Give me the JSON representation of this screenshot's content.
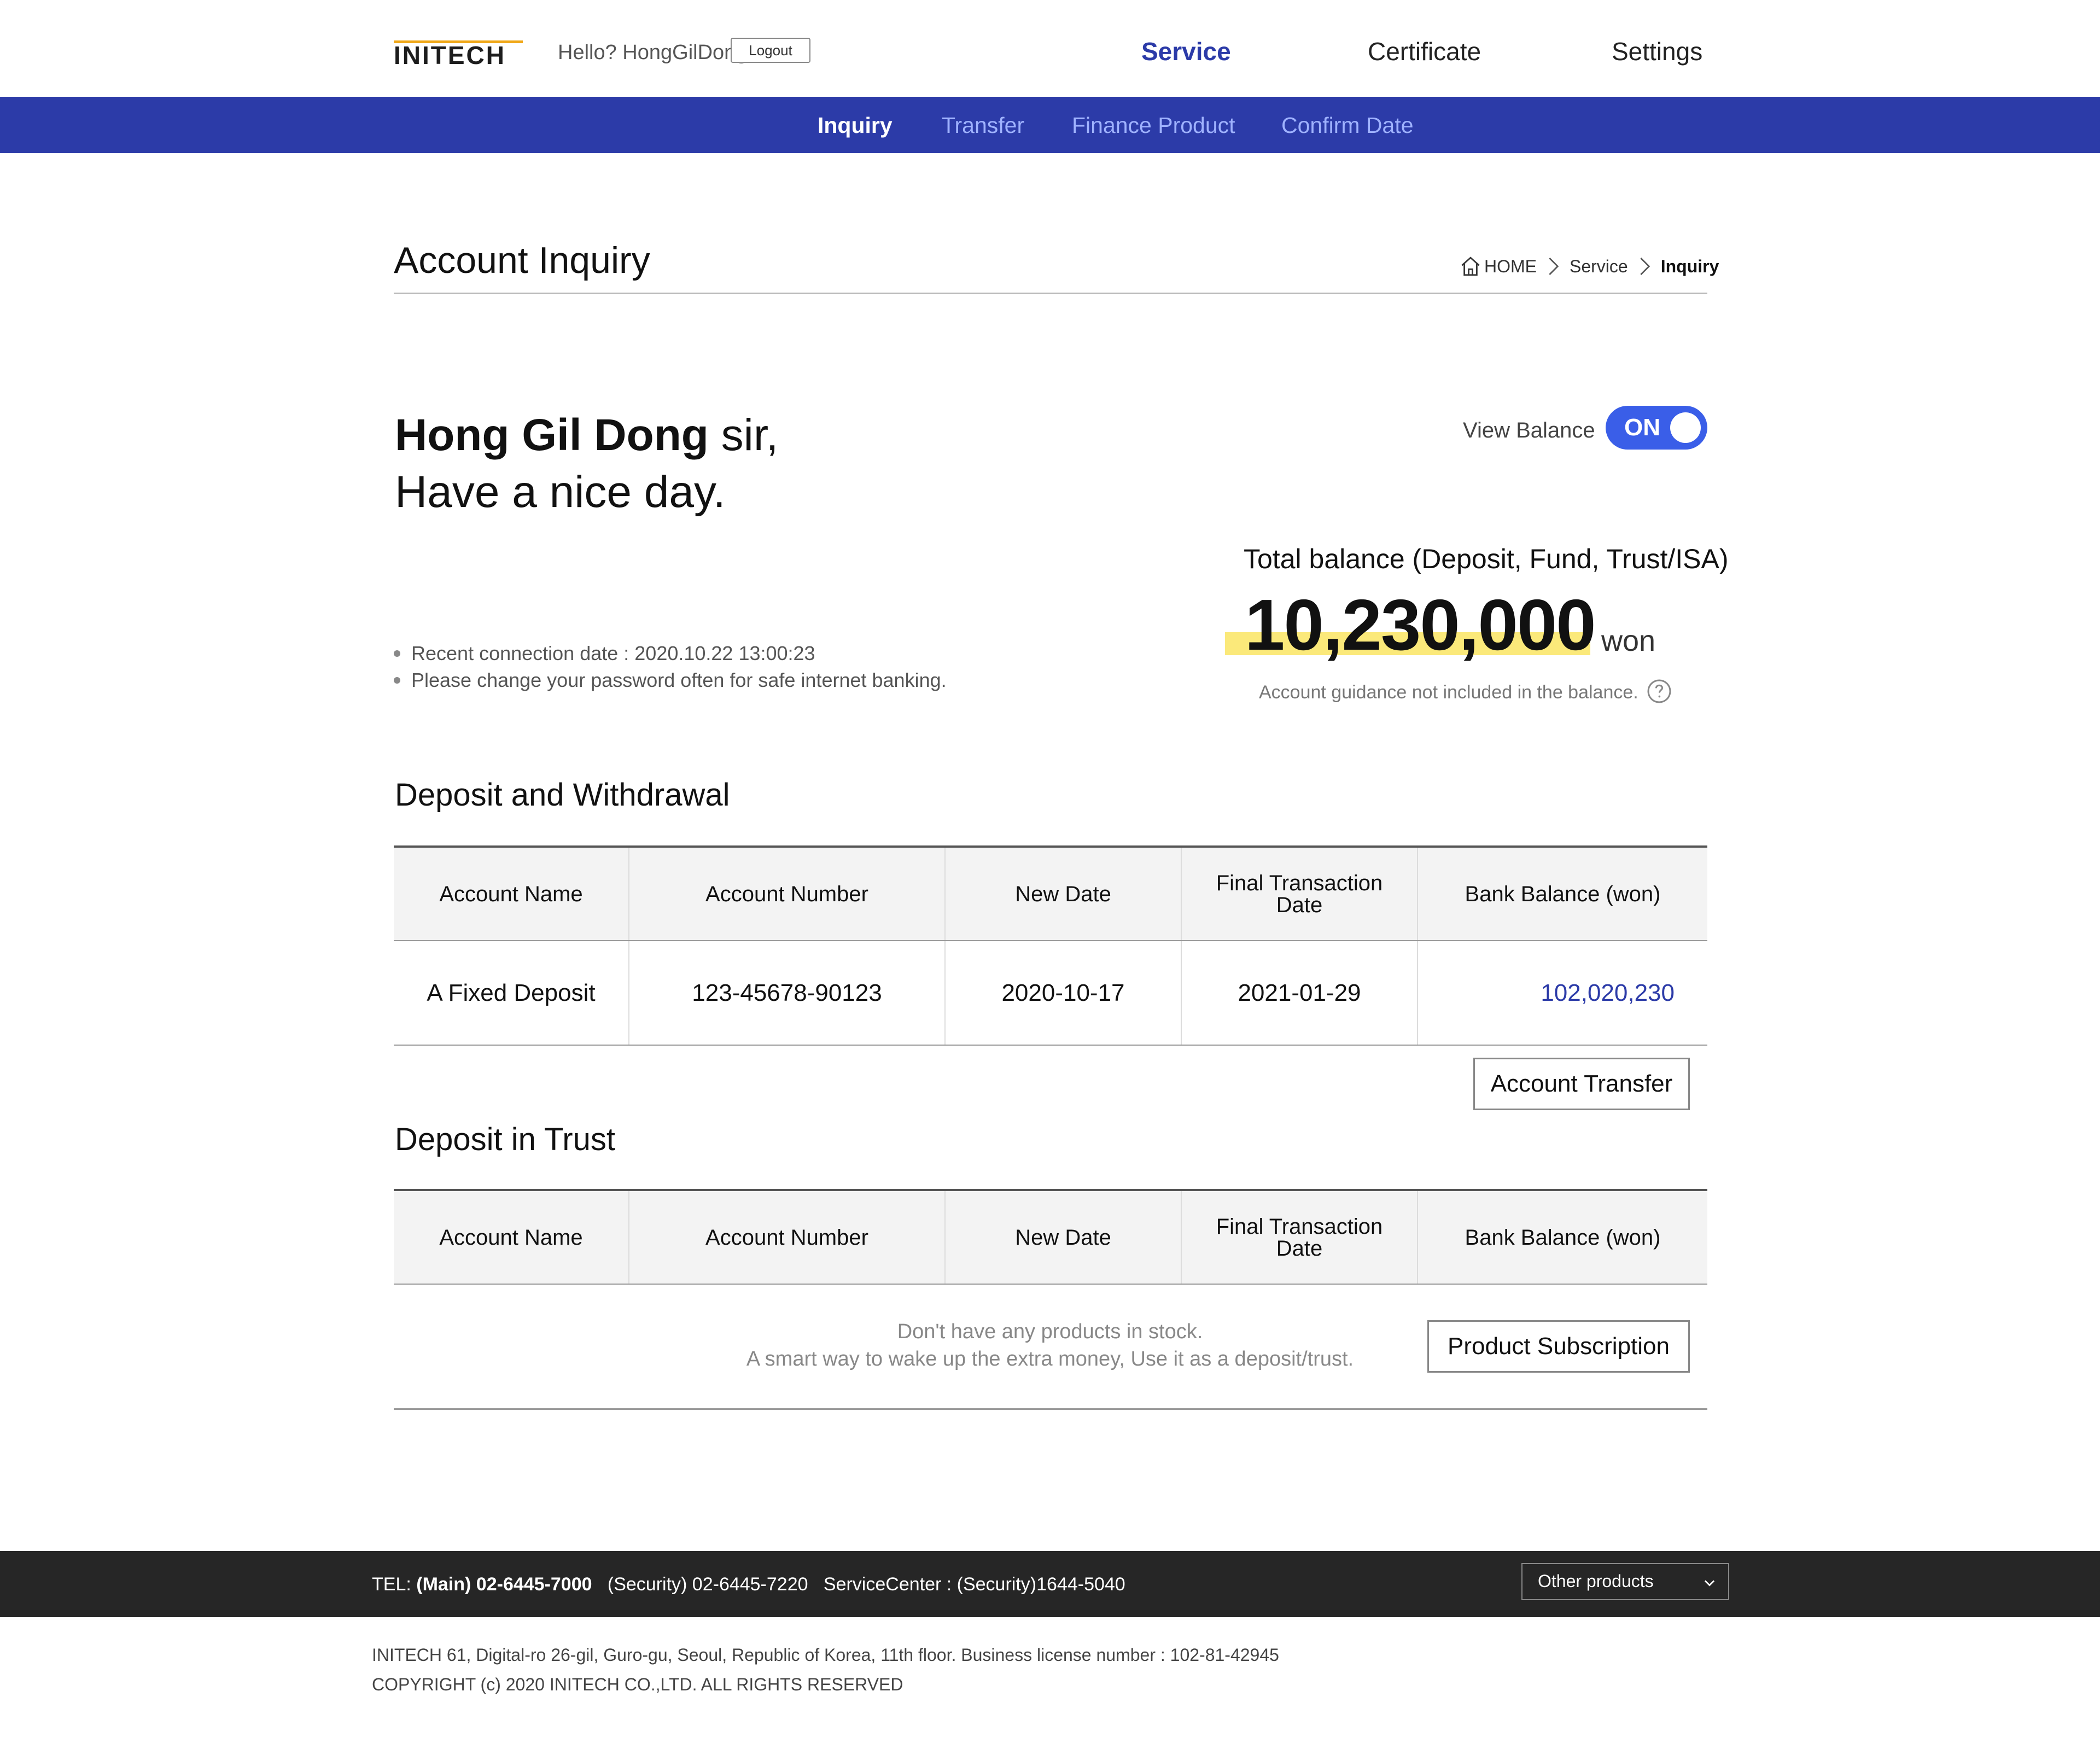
{
  "header": {
    "logo_text": "INITECH",
    "greeting": "Hello? HongGilDong",
    "logout_label": "Logout",
    "nav": [
      "Service",
      "Certificate",
      "Settings"
    ],
    "active_nav": "Service",
    "accent_color": "#2c3ba8"
  },
  "subnav": {
    "items": [
      "Inquiry",
      "Transfer",
      "Finance Product",
      "Confirm Date"
    ],
    "active": "Inquiry",
    "background_color": "#2c3ba8"
  },
  "page": {
    "title": "Account Inquiry",
    "breadcrumb": [
      "HOME",
      "Service",
      "Inquiry"
    ]
  },
  "welcome": {
    "name": "Hong Gil Dong",
    "suffix": " sir,",
    "line2": "Have a nice day.",
    "notices": [
      "Recent connection date : 2020.10.22 13:00:23",
      "Please change your password often for safe internet banking."
    ]
  },
  "balance": {
    "view_label": "View Balance",
    "toggle_text": "ON",
    "toggle_on": true,
    "total_label": "Total balance (Deposit, Fund, Trust/ISA)",
    "total_amount": "10,230,000",
    "unit": "won",
    "note": "Account guidance not included in the balance.",
    "help_icon": "question-circle-icon"
  },
  "deposit_section": {
    "title": "Deposit and Withdrawal",
    "columns": [
      "Account Name",
      "Account Number",
      "New Date",
      "Final Transaction Date",
      "Bank Balance (won)"
    ],
    "rows": [
      {
        "name": "A Fixed Deposit",
        "number": "123-45678-90123",
        "new_date": "2020-10-17",
        "final_date": "2021-01-29",
        "balance": "102,020,230"
      }
    ],
    "action_label": "Account Transfer"
  },
  "trust_section": {
    "title": "Deposit in Trust",
    "columns": [
      "Account Name",
      "Account Number",
      "New Date",
      "Final Transaction Date",
      "Bank Balance (won)"
    ],
    "empty_line1": "Don't have any products in stock.",
    "empty_line2": "A smart way to wake up the extra money, Use it as a deposit/trust.",
    "action_label": "Product Subscription"
  },
  "footer": {
    "tel_label": "TEL:",
    "main_phone": "(Main) 02-6445-7000",
    "security_phone": "(Security) 02-6445-7220",
    "service_center": "ServiceCenter : (Security)1644-5040",
    "other_products": "Other products",
    "address": "INITECH 61, Digital-ro 26-gil, Guro-gu, Seoul, Republic of Korea, 11th floor. Business license number : 102-81-42945",
    "copyright": "COPYRIGHT (c) 2020 INITECH CO.,LTD. ALL RIGHTS RESERVED"
  }
}
